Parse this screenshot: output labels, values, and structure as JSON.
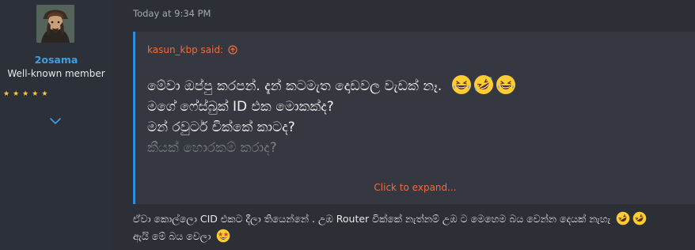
{
  "user": {
    "username": "2osama",
    "title": "Well-known member",
    "stars": [
      "★",
      "★",
      "★",
      "★",
      "★"
    ],
    "avatar_icon": "pirate-avatar"
  },
  "post": {
    "timestamp": "Today at 9:34 PM",
    "quote": {
      "author_said": "kasun_kbp said:",
      "lines": [
        "මේවා ඔප්පු කරපන්. දැන් කටමැත දොඩවල වැඩක් නෑ.",
        "මගේ ෆේස්බුක් ID එක මොකක්ද?",
        "මන් රවුටර් චික්කේ කාටද?",
        "කීයක් හොරකම් කරාද?"
      ],
      "expand_label": "Click to expand..."
    },
    "reply_lines": [
      "ඒවා කොල්ලො CID එකට දීලා තියෙන්නේ . උඹ Router වික්කේ නැත්නම් උඹ ට මෙහෙම බය වෙන්න දෙයක් නැහැ",
      "ඇයි මේ බය වෙලා"
    ]
  },
  "colors": {
    "accent_link": "#3d9fe3",
    "quote_accent": "#f26b3a",
    "quote_border": "#2d8ee0",
    "star": "#ffd100"
  }
}
